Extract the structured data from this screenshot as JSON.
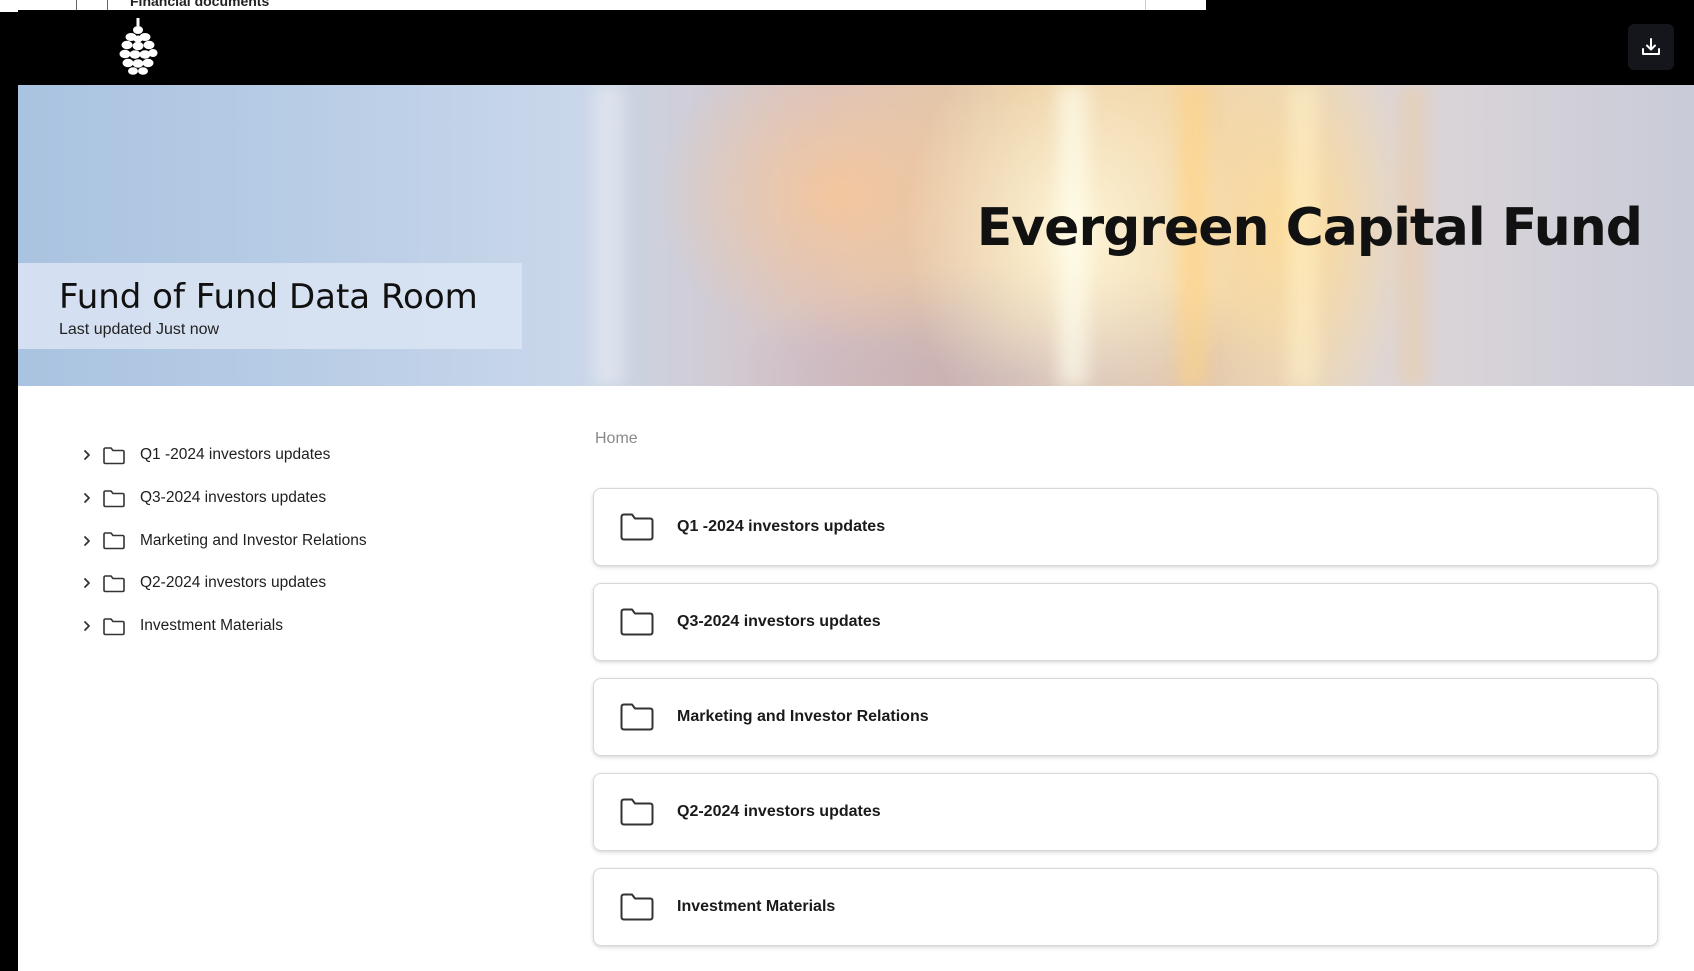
{
  "background_window": {
    "row_text": "Financial documents"
  },
  "header": {
    "logo_icon": "pinecone-logo-icon",
    "download_icon": "download-icon"
  },
  "hero": {
    "fund_name": "Evergreen Capital Fund",
    "room_title": "Fund of Fund Data Room",
    "last_updated": "Last updated Just now"
  },
  "sidebar": {
    "items": [
      {
        "label": "Q1 -2024 investors updates"
      },
      {
        "label": "Q3-2024 investors updates"
      },
      {
        "label": "Marketing and Investor Relations"
      },
      {
        "label": "Q2-2024 investors updates"
      },
      {
        "label": "Investment Materials"
      }
    ]
  },
  "main": {
    "breadcrumb": "Home",
    "folders": [
      {
        "label": "Q1 -2024 investors updates"
      },
      {
        "label": "Q3-2024 investors updates"
      },
      {
        "label": "Marketing and Investor Relations"
      },
      {
        "label": "Q2-2024 investors updates"
      },
      {
        "label": "Investment Materials"
      }
    ]
  },
  "colors": {
    "topbar": "#000000",
    "download_button": "#14161c",
    "card_border": "#d8d8d8",
    "breadcrumb": "#8a8a8a"
  }
}
